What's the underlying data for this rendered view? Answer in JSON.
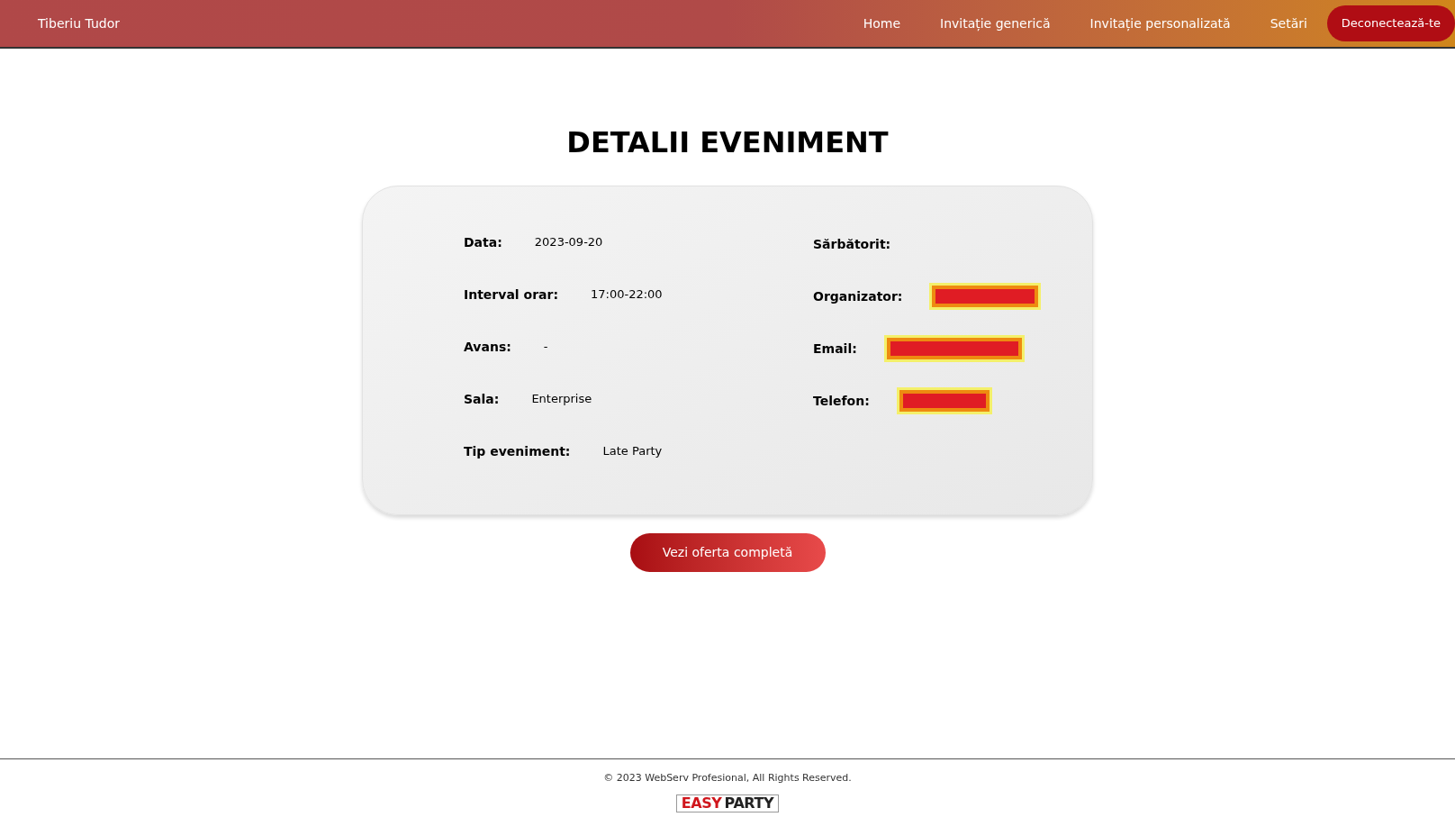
{
  "navbar": {
    "user": "Tiberiu Tudor",
    "links": [
      {
        "label": "Home"
      },
      {
        "label": "Invitație generică"
      },
      {
        "label": "Invitație personalizată"
      },
      {
        "label": "Setări"
      }
    ],
    "logout": "Deconectează-te"
  },
  "title": "DETALII EVENIMENT",
  "left_fields": [
    {
      "label": "Data:",
      "value": "2023-09-20"
    },
    {
      "label": "Interval orar:",
      "value": "17:00-22:00"
    },
    {
      "label": "Avans:",
      "value": "-"
    },
    {
      "label": "Sala:",
      "value": "Enterprise"
    },
    {
      "label": "Tip eveniment:",
      "value": "Late Party"
    }
  ],
  "right_fields": [
    {
      "label": "Sărbătorit:",
      "redacted": false
    },
    {
      "label": "Organizator:",
      "redacted": true
    },
    {
      "label": "Email:",
      "redacted": true
    },
    {
      "label": "Telefon:",
      "redacted": true
    }
  ],
  "button": "Vezi oferta completă",
  "footer": {
    "copyright": "© 2023 WebServ Profesional, All Rights Reserved.",
    "logo": [
      "EASY",
      "PARTY"
    ]
  }
}
